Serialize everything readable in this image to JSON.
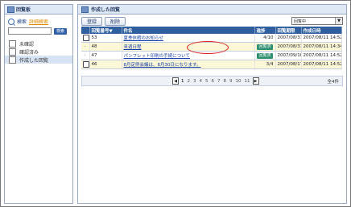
{
  "left": {
    "title": "回覧板",
    "search_label": "検索",
    "advanced_search_label": "詳細検索",
    "search_button": "検索",
    "tree": [
      {
        "label": "未確認"
      },
      {
        "label": "確認済み"
      },
      {
        "label": "作成した回覧"
      }
    ]
  },
  "right": {
    "title": "作成した回覧",
    "register_button": "登録",
    "delete_button": "削除",
    "filter_value": "回覧中",
    "columns": [
      "",
      "回覧番号▼",
      "件名",
      "進捗",
      "回覧期限",
      "作成日時"
    ],
    "rows": [
      {
        "num": "53",
        "subject": "夏季休暇のお知らせ",
        "progress": "4/10",
        "deadline": "2007/08/31",
        "created": "2007/08/11 14:52"
      },
      {
        "num": "48",
        "subject": "来週日程",
        "progress": "回覧済",
        "deadline": "2007/08/31",
        "created": "2007/08/11 14:34"
      },
      {
        "num": "47",
        "subject": "パンフレット印刷の手続について",
        "progress": "回覧済",
        "deadline": "2007/09/10",
        "created": "2007/08/11 14:52"
      },
      {
        "num": "46",
        "subject": "8月定例会議は、8月30日になります。",
        "progress": "3/4",
        "deadline": "2007/08/17",
        "created": "2007/08/11 14:52"
      }
    ],
    "pager": {
      "pages": [
        "1",
        "2",
        "3",
        "4",
        "5",
        "6",
        "7",
        "8",
        "9",
        "10",
        "11"
      ],
      "total": "全4件"
    }
  },
  "colors": {
    "header": "#2f5f9e",
    "badge": "#2e8f6f",
    "annotation": "#d81a1a"
  }
}
